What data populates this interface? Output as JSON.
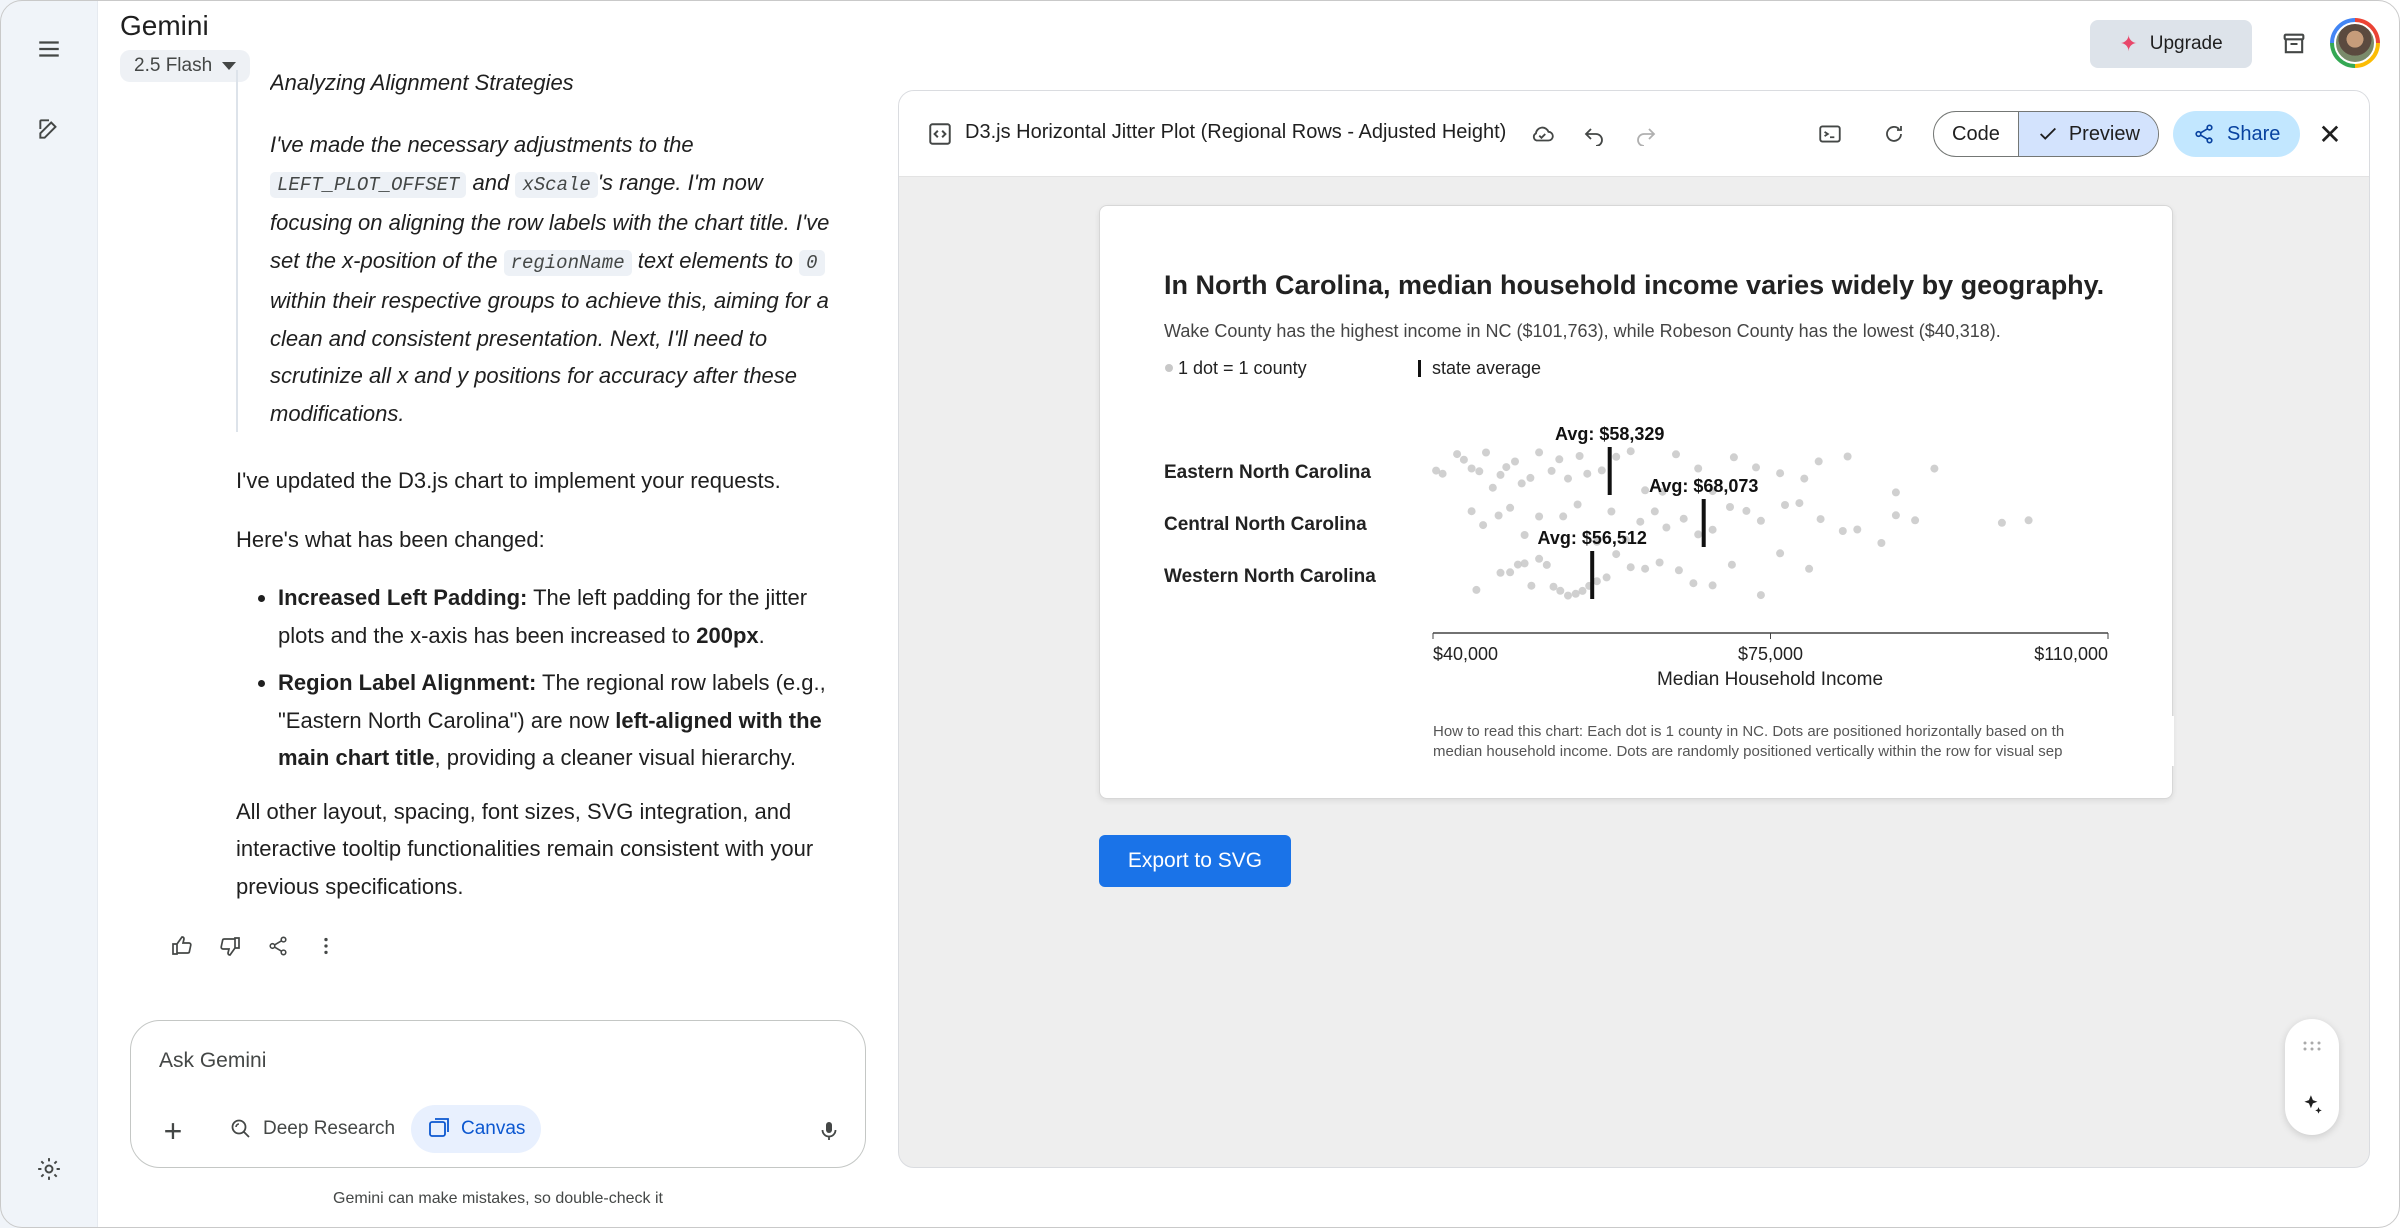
{
  "app": {
    "title": "Gemini",
    "model": "2.5 Flash",
    "upgrade_label": "Upgrade"
  },
  "sidebar": {
    "menu_icon": "menu-icon",
    "new_chat_icon": "edit-icon",
    "settings_icon": "settings-icon"
  },
  "thought": {
    "title": "Analyzing Alignment Strategies",
    "segments": [
      {
        "t": "text",
        "v": "I've made the necessary adjustments to the "
      },
      {
        "t": "code",
        "v": "LEFT_PLOT_OFFSET"
      },
      {
        "t": "text",
        "v": " and "
      },
      {
        "t": "code",
        "v": "xScale"
      },
      {
        "t": "text",
        "v": "'s range. I'm now focusing on aligning the row labels with the chart title. I've set the x-position of the "
      },
      {
        "t": "code",
        "v": "regionName"
      },
      {
        "t": "text",
        "v": " text elements to "
      },
      {
        "t": "code",
        "v": "0"
      },
      {
        "t": "text",
        "v": " within their respective groups to achieve this, aiming for a clean and consistent presentation. Next, I'll need to scrutinize all x and y positions for accuracy after these modifications."
      }
    ]
  },
  "reply": {
    "intro": "I've updated the D3.js chart to implement your requests.",
    "changes_heading": "Here's what has been changed:",
    "bullet1": {
      "bold": "Increased Left Padding:",
      "text": " The left padding for the jitter plots and the x-axis has been increased to ",
      "bold2": "200px",
      "tail": "."
    },
    "bullet2": {
      "bold": "Region Label Alignment:",
      "text": " The regional row labels (e.g., \"Eastern North Carolina\") are now ",
      "bold2": "left-aligned with the main chart title",
      "tail": ", providing a cleaner visual hierarchy."
    },
    "outro": "All other layout, spacing, font sizes, SVG integration, and interactive tooltip functionalities remain consistent with your previous specifications."
  },
  "input": {
    "placeholder": "Ask Gemini",
    "deep_research": "Deep Research",
    "canvas": "Canvas",
    "disclaimer": "Gemini can make mistakes, so double-check it"
  },
  "canvas_panel": {
    "title": "D3.js Horizontal Jitter Plot (Regional Rows - Adjusted Height)",
    "code_label": "Code",
    "preview_label": "Preview",
    "share_label": "Share",
    "export_label": "Export to SVG"
  },
  "chart_data": {
    "type": "scatter",
    "title": "In North Carolina, median household income varies widely by geography.",
    "subtitle": "Wake County has the highest income in NC ($101,763), while Robeson County has the lowest ($40,318).",
    "legend": {
      "dot": "1 dot = 1 county",
      "line": "state average"
    },
    "xlabel": "Median Household Income",
    "xlim": [
      40000,
      110000
    ],
    "x_ticks": [
      "$40,000",
      "$75,000",
      "$110,000"
    ],
    "x_tick_values": [
      40000,
      75000,
      110000
    ],
    "note_line1": "How to read this chart: Each dot is 1 county in NC. Dots are positioned horizontally based on th",
    "note_line2": "median household income. Dots are randomly positioned vertically within the row for visual sep",
    "dot_color": "#c8c8c8",
    "series": [
      {
        "name": "Eastern North Carolina",
        "average": 58329,
        "avg_label": "Avg: $58,329",
        "values": [
          40318,
          41000,
          42500,
          43200,
          44000,
          44800,
          45500,
          46200,
          47000,
          47600,
          48500,
          49200,
          50100,
          51000,
          52300,
          53100,
          54000,
          55200,
          56000,
          57500,
          59000,
          60500,
          62000,
          63800,
          65200,
          67500,
          69000,
          71200,
          73500,
          76000,
          78500,
          80000,
          83000,
          88000,
          92000
        ]
      },
      {
        "name": "Central North Carolina",
        "average": 68073,
        "avg_label": "Avg: $68,073",
        "values": [
          44000,
          45200,
          46800,
          48000,
          49500,
          51000,
          53500,
          55000,
          57000,
          58500,
          60000,
          61500,
          63000,
          64200,
          66000,
          67500,
          69000,
          70800,
          72500,
          74000,
          76500,
          78000,
          80200,
          82500,
          84000,
          86500,
          88000,
          90000,
          99000,
          101763
        ]
      },
      {
        "name": "Western North Carolina",
        "average": 56512,
        "avg_label": "Avg: $56,512",
        "values": [
          44500,
          47000,
          48000,
          48800,
          49500,
          50200,
          51000,
          51800,
          52500,
          53200,
          54000,
          54800,
          55500,
          56200,
          57000,
          58000,
          59000,
          60500,
          62000,
          63500,
          65500,
          67000,
          69000,
          71000,
          74000,
          76000,
          79000
        ]
      }
    ]
  }
}
